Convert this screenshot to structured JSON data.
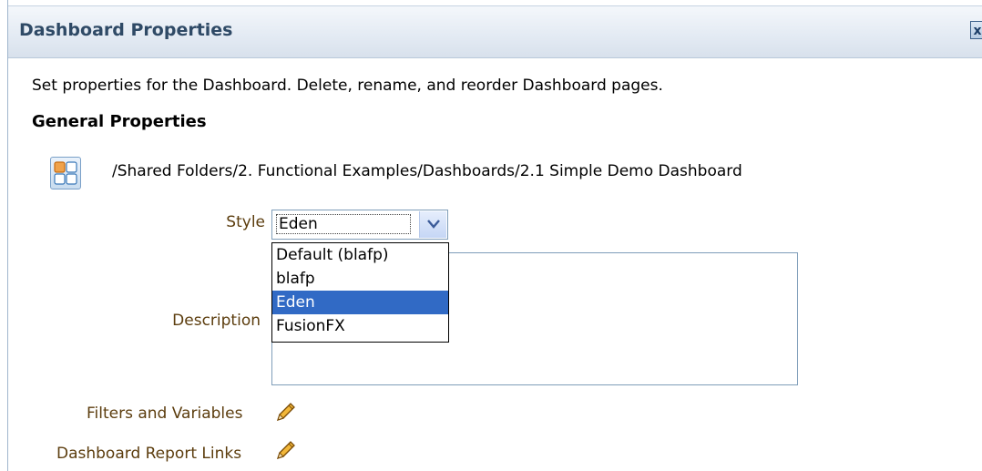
{
  "dialog": {
    "title": "Dashboard Properties",
    "close_label": "x"
  },
  "intro_text": "Set properties for the Dashboard. Delete, rename, and reorder Dashboard pages.",
  "general": {
    "heading": "General Properties",
    "path": "/Shared Folders/2. Functional Examples/Dashboards/2.1 Simple Demo Dashboard",
    "style_label": "Style",
    "style_value": "Eden",
    "style_options": [
      "Default (blafp)",
      "blafp",
      "Eden",
      "FusionFX"
    ],
    "description_label": "Description",
    "description_value": ""
  },
  "links": {
    "filters": "Filters and Variables",
    "report_links": "Dashboard Report Links"
  },
  "icons": {
    "dashboard": "dashboard-grid-icon",
    "pencil": "pencil-icon",
    "chevron": "chevron-down-icon"
  },
  "colors": {
    "title_text": "#2f4a66",
    "label_text": "#5c3d0e",
    "selected_option": "#316ac5"
  }
}
